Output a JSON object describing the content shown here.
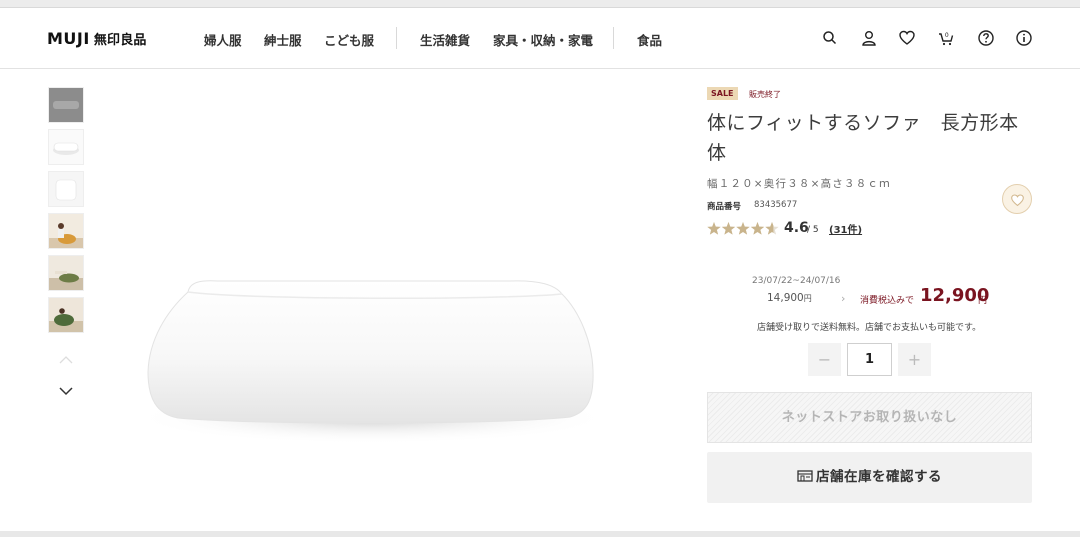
{
  "header": {
    "logo_en": "MUJI",
    "logo_jp": "無印良品",
    "nav": [
      "婦人服",
      "紳士服",
      "こども服",
      "生活雑貨",
      "家具・収納・家電",
      "食品"
    ],
    "icons": [
      "search-icon",
      "account-icon",
      "heart-icon",
      "cart-icon",
      "help-icon",
      "info-icon"
    ],
    "cart_count": "0"
  },
  "gallery": {
    "thumbnails": [
      "thumbnail-1",
      "thumbnail-2",
      "thumbnail-3",
      "thumbnail-4",
      "thumbnail-5",
      "thumbnail-6"
    ],
    "selected_index": 0
  },
  "product": {
    "sale_badge": "SALE",
    "status": "販売終了",
    "title": "体にフィットするソファ　長方形本体",
    "size": "幅１２０×奥行３８×高さ３８ｃｍ",
    "code_label": "商品番号",
    "code": "83435677",
    "rating": "4.6",
    "rating_max": "/ 5",
    "review_count": "(31件)",
    "rating_value": 4.6
  },
  "price": {
    "period": "23/07/22~24/07/16",
    "old_price": "14,900",
    "old_yen": "円",
    "tax_label": "消費税込みで",
    "new_price": "12,900",
    "new_yen": "円",
    "shipping_note": "店舗受け取りで送料無料。店舗でお支払いも可能です。"
  },
  "quantity": {
    "minus": "−",
    "value": "1",
    "plus": "+"
  },
  "buttons": {
    "not_available": "ネットストアお取り扱いなし",
    "check_store": "店舗在庫を確認する"
  },
  "colors": {
    "accent": "#7a1420",
    "sale_bg": "#ecd8b4",
    "star": "#c9b48c"
  }
}
